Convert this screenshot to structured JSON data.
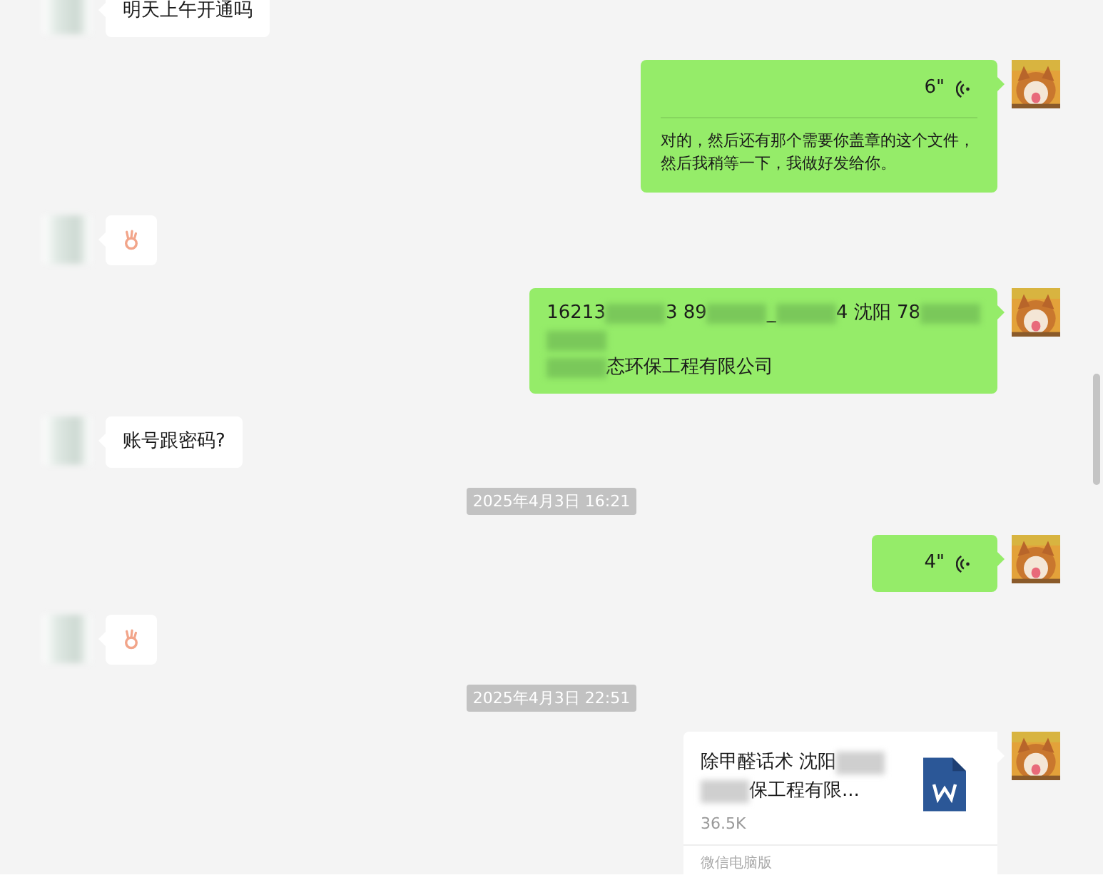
{
  "messages": [
    {
      "kind": "text",
      "outgoing": false,
      "lines": [
        [
          {
            "kind": "text",
            "text": "明天上午开通吗"
          }
        ]
      ]
    },
    {
      "kind": "voice",
      "outgoing": true,
      "duration": "6\"",
      "transcript": "对的，然后还有那个需要你盖章的这个文件，然后我稍等一下，我做好发给你。"
    },
    {
      "kind": "emoji",
      "outgoing": false
    },
    {
      "kind": "text",
      "outgoing": true,
      "lines": [
        [
          {
            "kind": "text",
            "text": "16213"
          },
          {
            "kind": "blur"
          },
          {
            "kind": "text",
            "text": "3 89"
          },
          {
            "kind": "blur"
          },
          {
            "kind": "text",
            "text": "_"
          },
          {
            "kind": "blur"
          },
          {
            "kind": "text",
            "text": "4 沈阳 78"
          },
          {
            "kind": "blur"
          }
        ],
        [
          {
            "kind": "blur"
          }
        ],
        [
          {
            "kind": "blur"
          },
          {
            "kind": "text",
            "text": "态环保工程有限公司"
          }
        ]
      ]
    },
    {
      "kind": "text",
      "outgoing": false,
      "lines": [
        [
          {
            "kind": "text",
            "text": "账号跟密码?"
          }
        ]
      ]
    },
    {
      "kind": "time",
      "text": "2025年4月3日 16:21"
    },
    {
      "kind": "voice",
      "outgoing": true,
      "duration": "4\""
    },
    {
      "kind": "emoji",
      "outgoing": false
    },
    {
      "kind": "time",
      "text": "2025年4月3日 22:51"
    },
    {
      "kind": "file",
      "outgoing": true,
      "title_lines": [
        [
          {
            "kind": "text",
            "text": "除甲醛话术 沈阳"
          },
          {
            "kind": "blur"
          }
        ],
        [
          {
            "kind": "blur"
          },
          {
            "kind": "text",
            "text": "保工程有限..."
          }
        ]
      ],
      "size": "36.5K",
      "source": "微信电脑版"
    }
  ]
}
